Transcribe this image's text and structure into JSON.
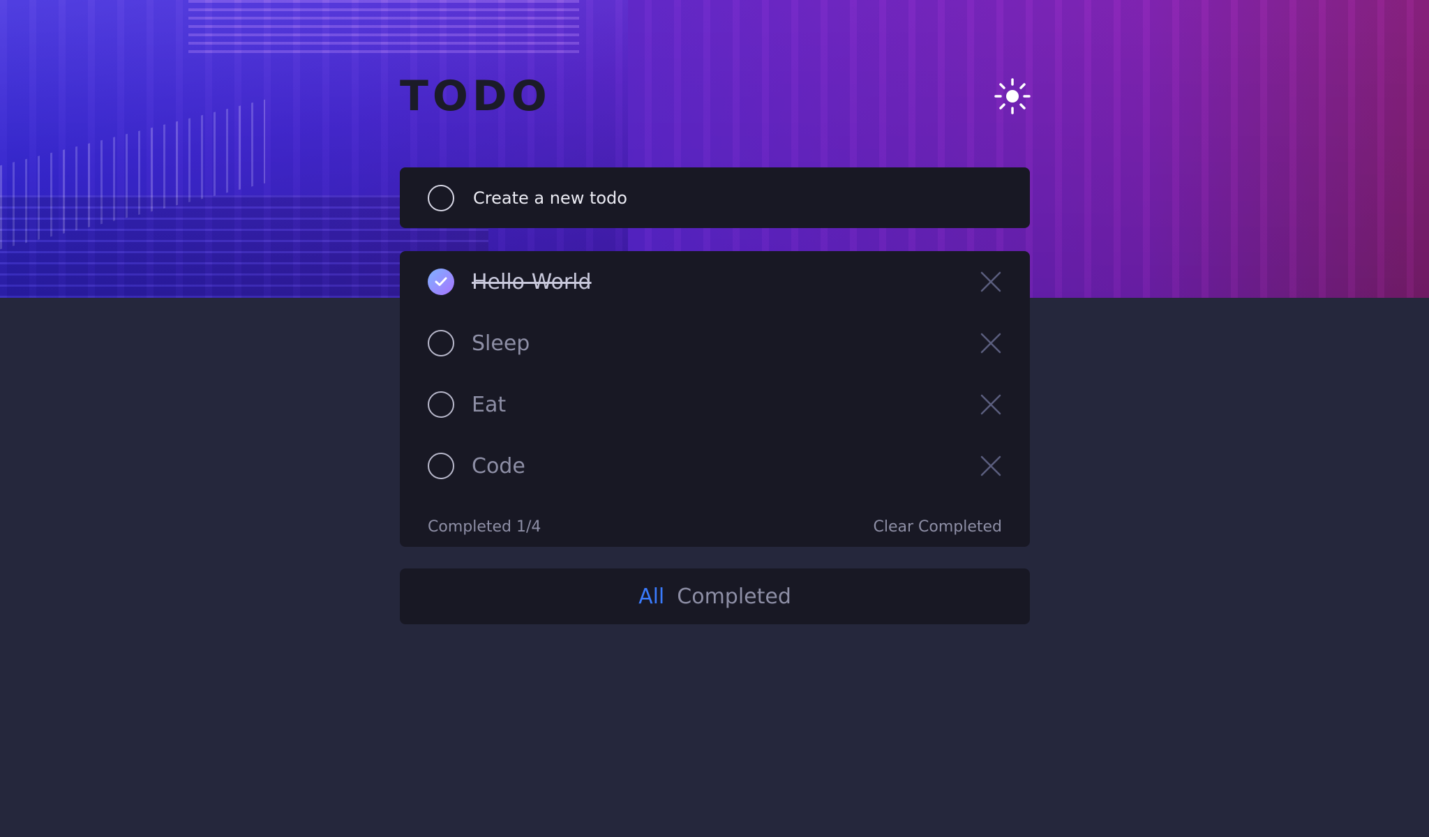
{
  "header": {
    "title": "TODO",
    "theme_icon": "sun-icon"
  },
  "new_todo": {
    "placeholder": "Create a new todo"
  },
  "todos": [
    {
      "label": "Hello World",
      "completed": true
    },
    {
      "label": "Sleep",
      "completed": false
    },
    {
      "label": "Eat",
      "completed": false
    },
    {
      "label": "Code",
      "completed": false
    }
  ],
  "summary": {
    "completed_text": "Completed 1/4",
    "clear_label": "Clear Completed"
  },
  "filters": {
    "all_label": "All",
    "completed_label": "Completed",
    "active": "All"
  },
  "colors": {
    "background": "#25273c",
    "card": "#181824",
    "accent": "#3a7bfd",
    "check_gradient_start": "#7fb2ff",
    "check_gradient_end": "#a774ff"
  }
}
